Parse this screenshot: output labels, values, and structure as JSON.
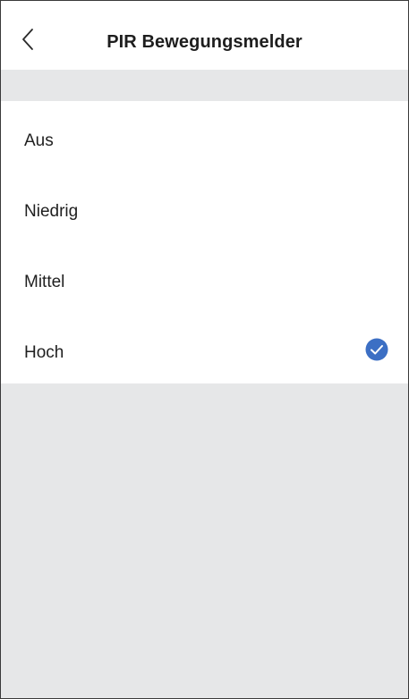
{
  "header": {
    "title": "PIR Bewegungsmelder",
    "back_icon": "chevron-left-icon"
  },
  "options": [
    {
      "label": "Aus",
      "selected": false
    },
    {
      "label": "Niedrig",
      "selected": false
    },
    {
      "label": "Mittel",
      "selected": false
    },
    {
      "label": "Hoch",
      "selected": true
    }
  ],
  "selected_icon": "check-circle-icon",
  "colors": {
    "accent": "#3c6fc4",
    "background": "#e6e7e8",
    "surface": "#ffffff",
    "text": "#1f1f1f"
  }
}
